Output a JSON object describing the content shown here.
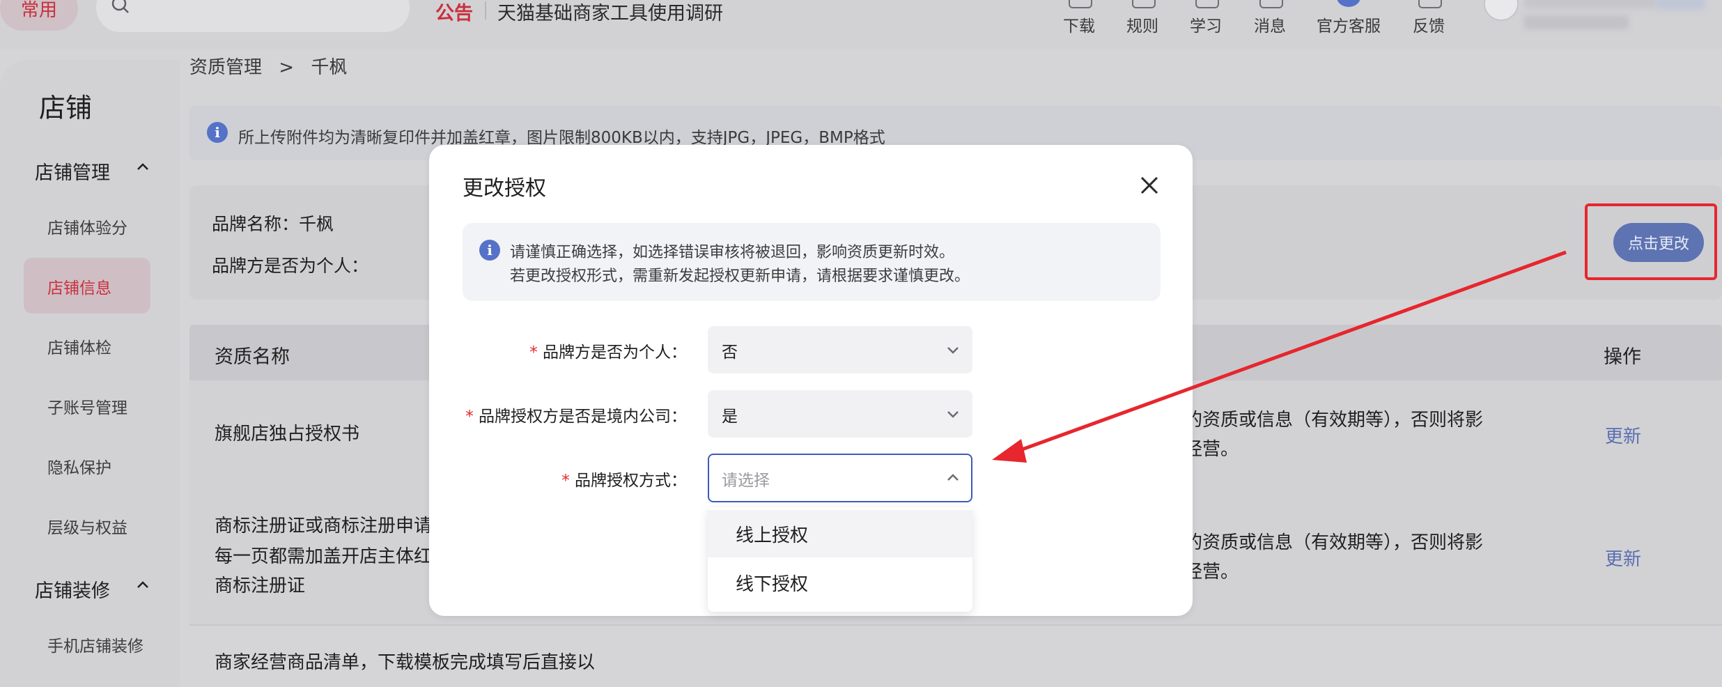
{
  "header": {
    "common_label": "常用",
    "notice_tag": "公告",
    "notice_text": "天猫基础商家工具使用调研",
    "nav": [
      {
        "label": "下载",
        "icon": "download-icon"
      },
      {
        "label": "规则",
        "icon": "rules-icon"
      },
      {
        "label": "学习",
        "icon": "learn-icon"
      },
      {
        "label": "消息",
        "icon": "message-icon"
      },
      {
        "label": "官方客服",
        "icon": "support-icon"
      },
      {
        "label": "反馈",
        "icon": "feedback-icon"
      }
    ]
  },
  "sidebar": {
    "title": "店铺",
    "groups": [
      {
        "label": "店铺管理",
        "items": [
          "店铺体验分",
          "店铺信息",
          "店铺体检",
          "子账号管理",
          "隐私保护",
          "层级与权益"
        ]
      },
      {
        "label": "店铺装修",
        "items": [
          "手机店铺装修"
        ]
      }
    ],
    "active_item": "店铺信息"
  },
  "main": {
    "breadcrumb": [
      "资质管理",
      "千枫"
    ],
    "breadcrumb_sep": ">",
    "info_text": "所上传附件均为清晰复印件并加盖红章，图片限制800KB以内，支持JPG，JPEG，BMP格式",
    "brand_name_label": "品牌名称：千枫",
    "brand_personal_label": "品牌方是否为个人：",
    "change_button": "点击更改",
    "table": {
      "col_name": "资质名称",
      "col_action": "操作",
      "rows": [
        {
          "name_lines": [
            "旗舰店独占授权书"
          ],
          "note_lines": [
            "的资质或信息（有效期等），否则将影",
            "经营。"
          ],
          "action": "更新"
        },
        {
          "name_lines": [
            "商标注册证或商标注册申请",
            "每一页都需加盖开店主体红",
            "商标注册证"
          ],
          "note_lines": [
            "的资质或信息（有效期等），否则将影",
            "经营。"
          ],
          "action": "更新"
        },
        {
          "name_lines": [
            "商家经营商品清单，下载模板完成填写后直接以"
          ],
          "note_lines": [],
          "action": ""
        }
      ]
    }
  },
  "modal": {
    "title": "更改授权",
    "alert_line1": "请谨慎正确选择，如选择错误审核将被退回，影响资质更新时效。",
    "alert_line2": "若更改授权形式，需重新发起授权更新申请，请根据要求谨慎更改。",
    "fields": [
      {
        "label": "品牌方是否为个人：",
        "value": "否",
        "placeholder": ""
      },
      {
        "label": "品牌授权方是否是境内公司：",
        "value": "是",
        "placeholder": ""
      },
      {
        "label": "品牌授权方式：",
        "value": "",
        "placeholder": "请选择"
      }
    ],
    "required_mark": "*",
    "dropdown_options": [
      "线上授权",
      "线下授权"
    ]
  },
  "colors": {
    "brand_red": "#c9303e",
    "accent_blue": "#3d5bb7",
    "annotation_red": "#e7262e"
  }
}
